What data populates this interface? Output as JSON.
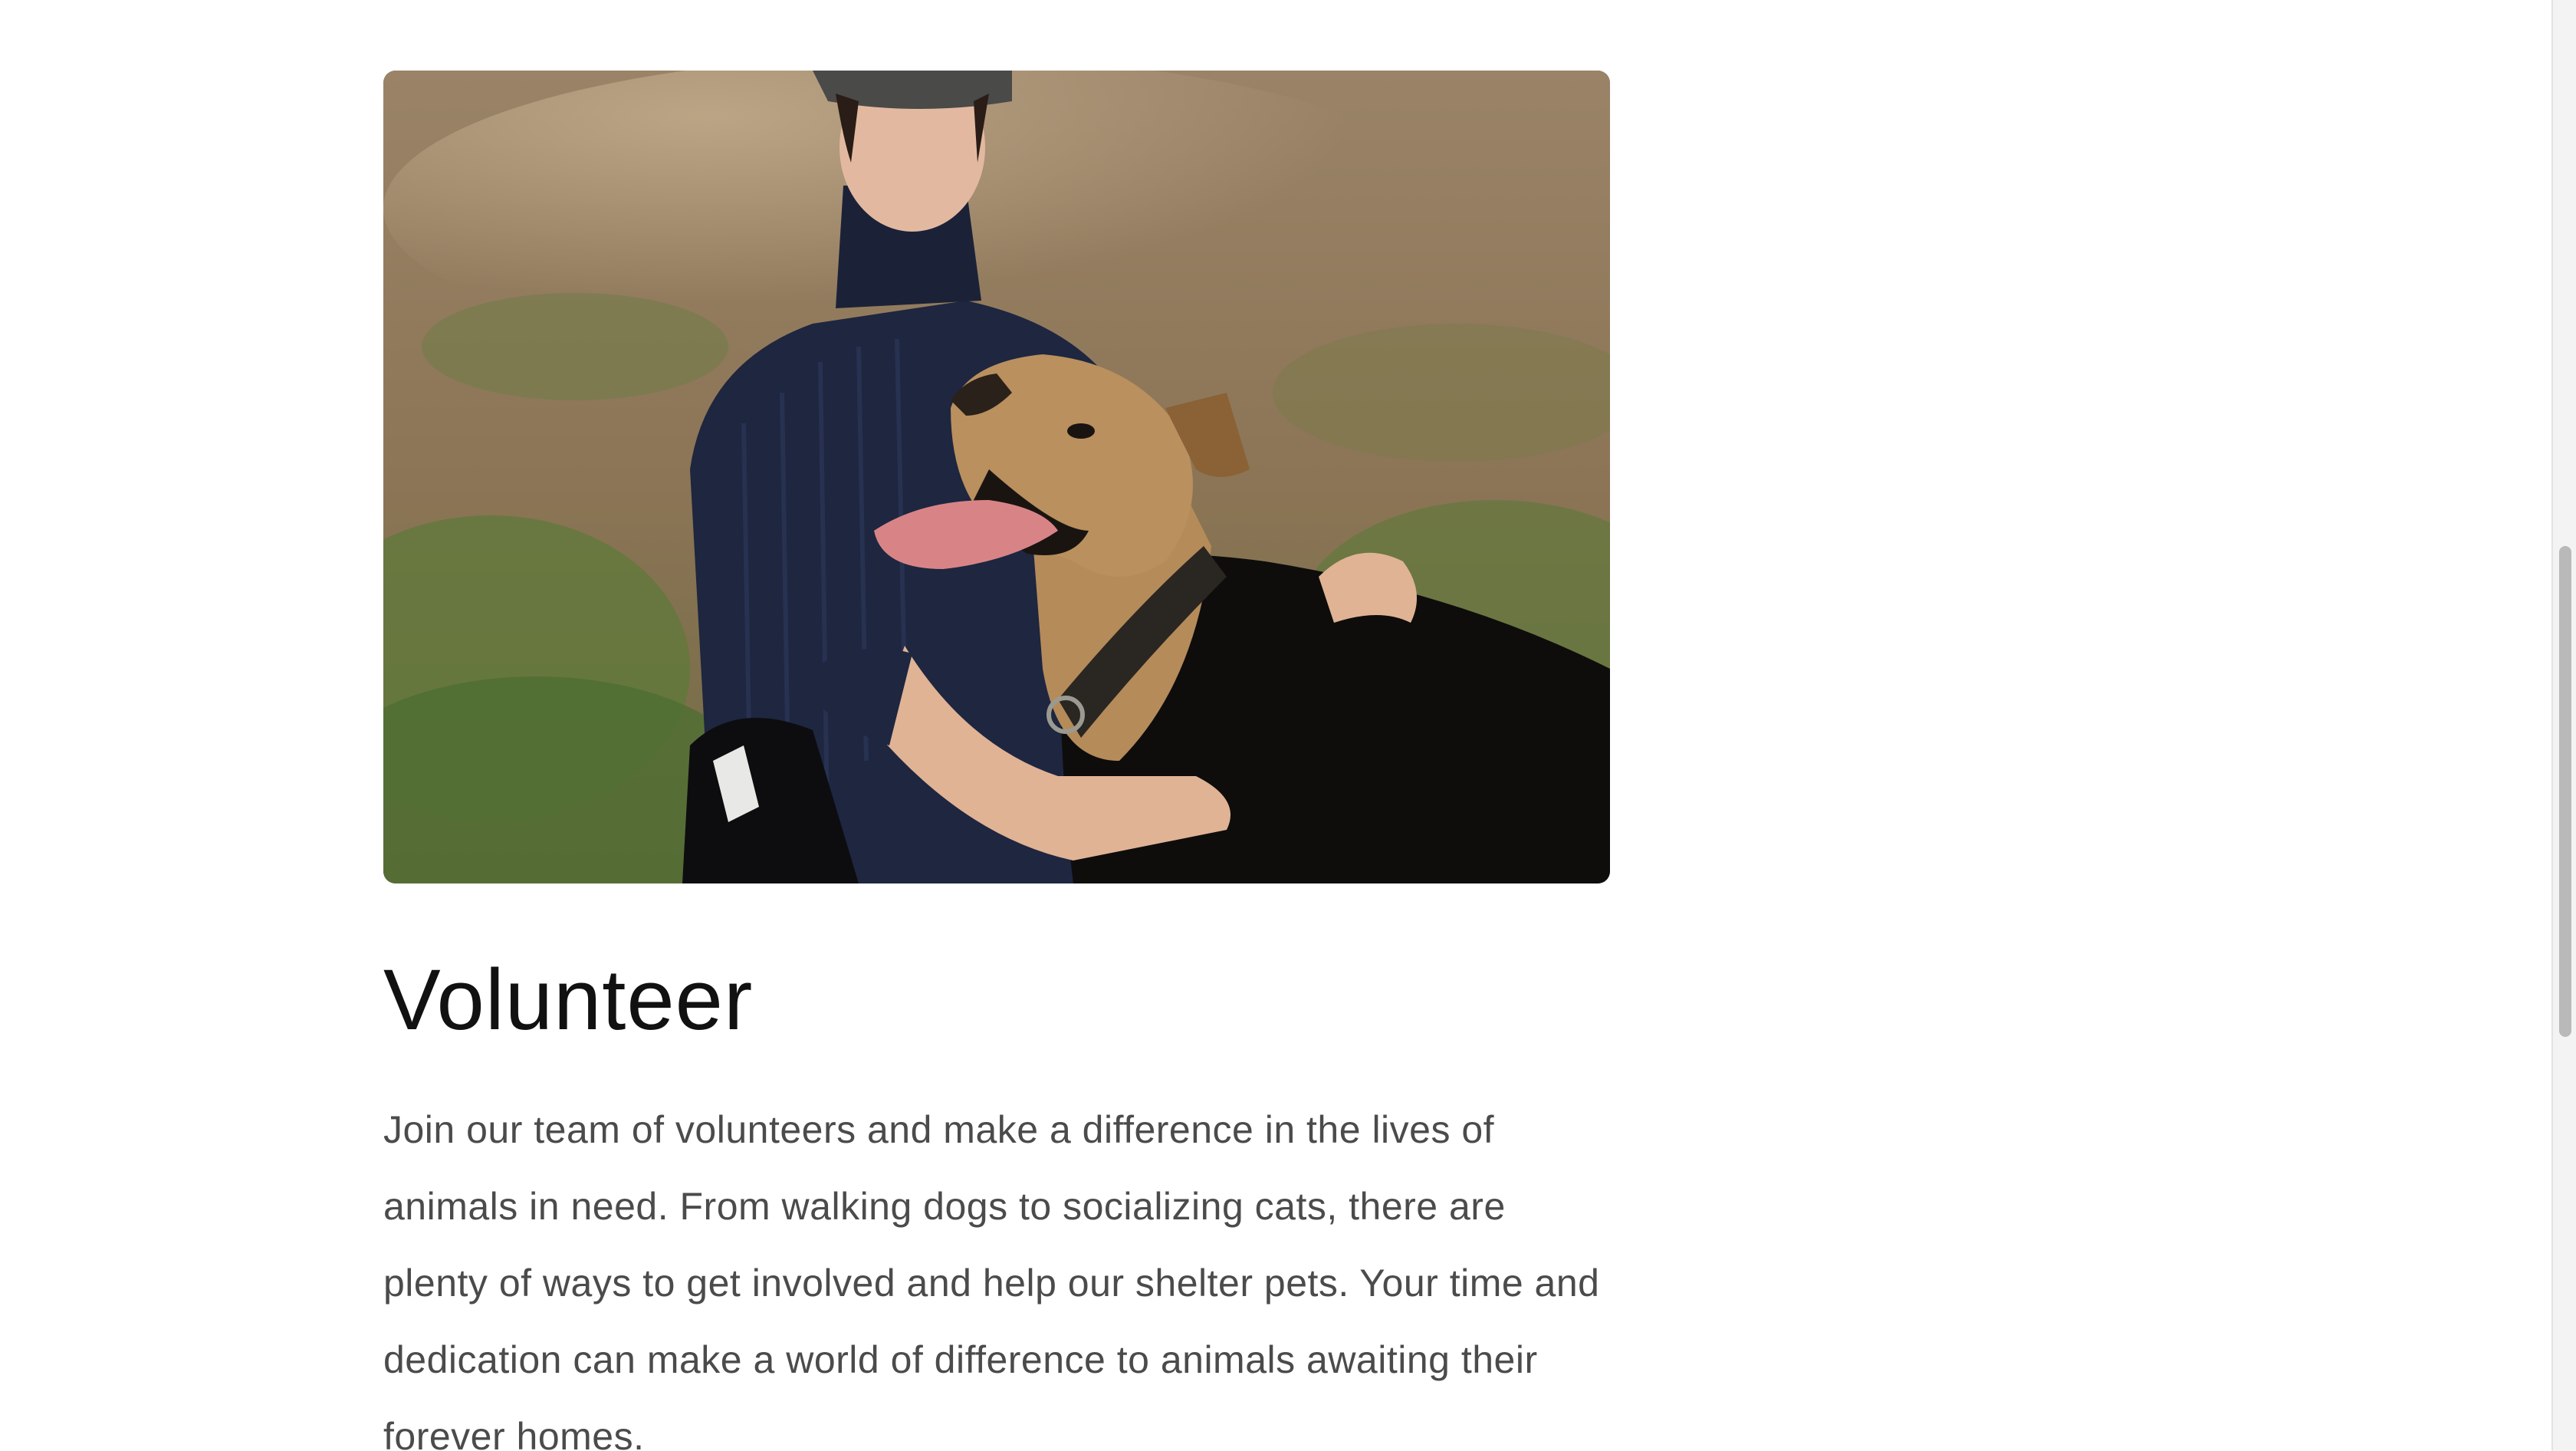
{
  "hero_image": {
    "alt": "Young man in a navy knit sweater petting a happy German Shepherd mix dog outdoors"
  },
  "section": {
    "title": "Volunteer",
    "body": "Join our team of volunteers and make a difference in the lives of animals in need. From walking dogs to socializing cats, there are plenty of ways to get involved and help our shelter pets. Your time and dedication can make a world of difference to animals awaiting their forever homes."
  },
  "colors": {
    "title": "#111111",
    "body": "#4b4b4b",
    "background": "#ffffff"
  }
}
